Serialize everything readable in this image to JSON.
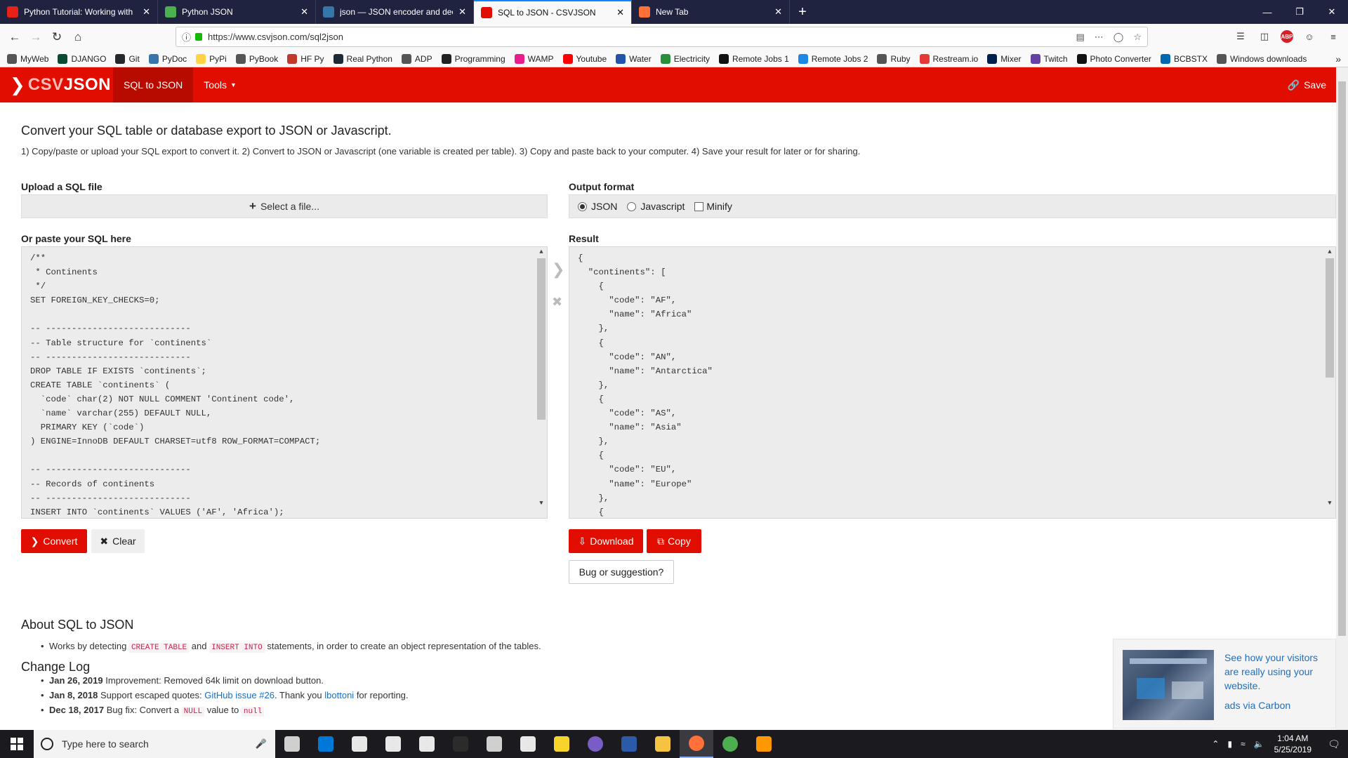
{
  "browser": {
    "tabs": [
      {
        "title": "Python Tutorial: Working with",
        "color": "#e62117"
      },
      {
        "title": "Python JSON",
        "color": "#4caf50"
      },
      {
        "title": "json — JSON encoder and dec",
        "color": "#3776ab"
      },
      {
        "title": "SQL to JSON - CSVJSON",
        "color": "#e00d00"
      },
      {
        "title": "New Tab",
        "color": "#ff7139"
      }
    ],
    "active_tab": 3,
    "url": "https://www.csvjson.com/sql2json",
    "bookmarks": [
      {
        "label": "MyWeb",
        "color": "#555555"
      },
      {
        "label": "DJANGO",
        "color": "#0c4b33"
      },
      {
        "label": "Git",
        "color": "#24292e"
      },
      {
        "label": "PyDoc",
        "color": "#3776ab"
      },
      {
        "label": "PyPi",
        "color": "#ffd343"
      },
      {
        "label": "PyBook",
        "color": "#555555"
      },
      {
        "label": "HF Py",
        "color": "#c0392b"
      },
      {
        "label": "Real Python",
        "color": "#1d2b36"
      },
      {
        "label": "ADP",
        "color": "#555555"
      },
      {
        "label": "Programming",
        "color": "#222222"
      },
      {
        "label": "WAMP",
        "color": "#e91e8c"
      },
      {
        "label": "Youtube",
        "color": "#ff0000"
      },
      {
        "label": "Water",
        "color": "#2255aa"
      },
      {
        "label": "Electricity",
        "color": "#2a8f3c"
      },
      {
        "label": "Remote Jobs 1",
        "color": "#111111"
      },
      {
        "label": "Remote Jobs 2",
        "color": "#1e88e5"
      },
      {
        "label": "Ruby",
        "color": "#555555"
      },
      {
        "label": "Restream.io",
        "color": "#e53935"
      },
      {
        "label": "Mixer",
        "color": "#002050"
      },
      {
        "label": "Twitch",
        "color": "#6441a5"
      },
      {
        "label": "Photo Converter",
        "color": "#111111"
      },
      {
        "label": "BCBSTX",
        "color": "#0067b1"
      },
      {
        "label": "Windows downloads",
        "color": "#555555"
      }
    ]
  },
  "site": {
    "brand_a": "CSV",
    "brand_b": "JSON",
    "nav_active": "SQL to JSON",
    "nav_tools": "Tools",
    "save_label": "Save"
  },
  "page": {
    "title": "Convert your SQL table or database export to JSON or Javascript.",
    "instructions": "1) Copy/paste or upload your SQL export to convert it. 2) Convert to JSON or Javascript (one variable is created per table). 3) Copy and paste back to your computer. 4) Save your result for later or for sharing.",
    "upload_label": "Upload a SQL file",
    "select_file": "Select a file...",
    "paste_label": "Or paste your SQL here",
    "output_format_label": "Output format",
    "format_json": "JSON",
    "format_js": "Javascript",
    "format_minify": "Minify",
    "result_label": "Result",
    "sql_text": "/**\n * Continents\n */\nSET FOREIGN_KEY_CHECKS=0;\n\n-- ----------------------------\n-- Table structure for `continents`\n-- ----------------------------\nDROP TABLE IF EXISTS `continents`;\nCREATE TABLE `continents` (\n  `code` char(2) NOT NULL COMMENT 'Continent code',\n  `name` varchar(255) DEFAULT NULL,\n  PRIMARY KEY (`code`)\n) ENGINE=InnoDB DEFAULT CHARSET=utf8 ROW_FORMAT=COMPACT;\n\n-- ----------------------------\n-- Records of continents\n-- ----------------------------\nINSERT INTO `continents` VALUES ('AF', 'Africa');",
    "json_text": "{\n  \"continents\": [\n    {\n      \"code\": \"AF\",\n      \"name\": \"Africa\"\n    },\n    {\n      \"code\": \"AN\",\n      \"name\": \"Antarctica\"\n    },\n    {\n      \"code\": \"AS\",\n      \"name\": \"Asia\"\n    },\n    {\n      \"code\": \"EU\",\n      \"name\": \"Europe\"\n    },\n    {",
    "convert_label": "Convert",
    "clear_label": "Clear",
    "download_label": "Download",
    "copy_label": "Copy",
    "bug_label": "Bug or suggestion?",
    "about_title": "About SQL to JSON",
    "about_prefix": "Works by detecting",
    "about_kw1": "CREATE TABLE",
    "about_and": "and",
    "about_kw2": "INSERT INTO",
    "about_suffix": "statements, in order to create an object representation of the tables.",
    "changelog_title": "Change Log",
    "changelog": [
      {
        "date": "Jan 26, 2019",
        "text": "Improvement: Removed 64k limit on download button."
      },
      {
        "date": "Jan 8, 2018",
        "text_a": "Support escaped quotes:",
        "link1": "GitHub issue #26",
        "text_b": ". Thank you",
        "link2": "lbottoni",
        "text_c": "for reporting."
      },
      {
        "date": "Dec 18, 2017",
        "text_a": "Bug fix: Convert a",
        "kw1": "NULL",
        "text_b": "value to",
        "kw2": "null"
      }
    ],
    "ad_text": "See how your visitors are really using your website.",
    "ad_via": "ads via Carbon"
  },
  "taskbar": {
    "search_placeholder": "Type here to search",
    "apps": [
      {
        "name": "task-view-icon",
        "color": "#d0d0d0"
      },
      {
        "name": "edge-icon",
        "color": "#0078d7"
      },
      {
        "name": "store-icon",
        "color": "#e8e8e8"
      },
      {
        "name": "file-icon",
        "color": "#e8e8e8"
      },
      {
        "name": "mail-icon",
        "color": "#e8e8e8"
      },
      {
        "name": "terminal-icon",
        "color": "#2b2b2b"
      },
      {
        "name": "calculator-icon",
        "color": "#d0d0d0"
      },
      {
        "name": "brightness-icon",
        "color": "#e8e8e8"
      },
      {
        "name": "sticky-notes-icon",
        "color": "#f7d42c"
      },
      {
        "name": "app-purple-icon",
        "color": "#7a5cc7"
      },
      {
        "name": "powershell-icon",
        "color": "#2a5aa8"
      },
      {
        "name": "explorer-icon",
        "color": "#f5c342"
      },
      {
        "name": "firefox-icon",
        "color": "#ff7139"
      },
      {
        "name": "chrome-icon",
        "color": "#4caf50"
      },
      {
        "name": "sublime-icon",
        "color": "#ff9800"
      }
    ],
    "active_app": 12,
    "time": "1:04 AM",
    "date": "5/25/2019"
  }
}
